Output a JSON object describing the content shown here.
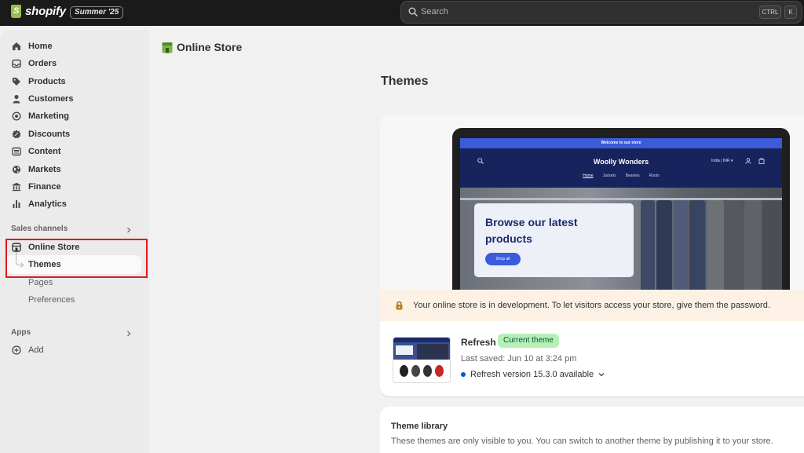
{
  "topbar": {
    "brand": "shopify",
    "edition_badge": "Summer '25",
    "search_placeholder": "Search",
    "shortcut_ctrl": "CTRL",
    "shortcut_key": "K"
  },
  "sidebar": {
    "items": [
      {
        "label": "Home",
        "icon": "home-icon"
      },
      {
        "label": "Orders",
        "icon": "inbox-icon"
      },
      {
        "label": "Products",
        "icon": "tag-icon"
      },
      {
        "label": "Customers",
        "icon": "person-icon"
      },
      {
        "label": "Marketing",
        "icon": "target-icon"
      },
      {
        "label": "Discounts",
        "icon": "discount-icon"
      },
      {
        "label": "Content",
        "icon": "content-icon"
      },
      {
        "label": "Markets",
        "icon": "globe-icon"
      },
      {
        "label": "Finance",
        "icon": "bank-icon"
      },
      {
        "label": "Analytics",
        "icon": "bar-chart-icon"
      }
    ],
    "sales_channels_label": "Sales channels",
    "online_store_label": "Online Store",
    "sub_items": [
      "Themes",
      "Pages",
      "Preferences"
    ],
    "apps_label": "Apps",
    "add_label": "Add"
  },
  "main": {
    "store_title": "Online Store",
    "page_title": "Themes",
    "preview": {
      "announcement": "Welcome to our store",
      "shop_name": "Woolly Wonders",
      "locale": "India | INR ▾",
      "menu": [
        "Home",
        "Jackets",
        "Beanies",
        "Roots"
      ],
      "hero_title": "Browse our latest products",
      "hero_button": "Shop all"
    },
    "dev_banner": "Your online store is in development. To let visitors access your store, give them the password.",
    "current_theme": {
      "name": "Refresh",
      "badge": "Current theme",
      "last_saved": "Last saved: Jun 10 at 3:24 pm",
      "version": "Refresh version 15.3.0 available"
    },
    "library": {
      "title": "Theme library",
      "description": "These themes are only visible to you. You can switch to another theme by publishing it to your store."
    }
  },
  "colors": {
    "topbar_bg": "#1a1a1a",
    "highlight_border": "#e01a1a",
    "badge_green": "#b4f0b8",
    "banner_bg": "#fdf1e6",
    "preview_navy": "#1a2a6c"
  }
}
